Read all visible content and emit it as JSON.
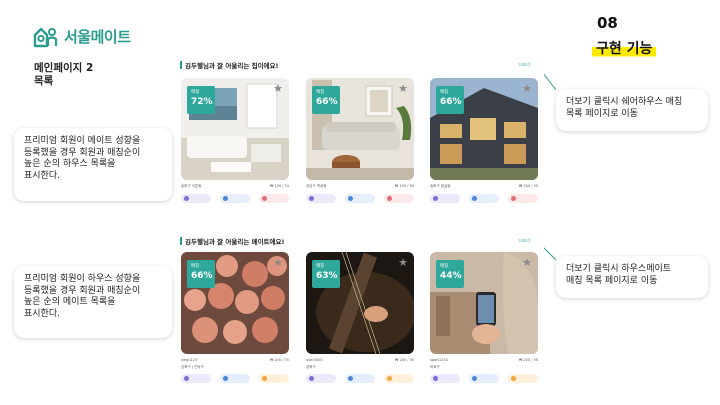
{
  "logo": {
    "text": "서울메이트"
  },
  "page_title": {
    "line1": "메인페이지 2",
    "line2": "목록"
  },
  "section": {
    "number": "08",
    "title": "구현 기능"
  },
  "notes": {
    "left_top": "프리미엄 회원이 메이트 성향을\n등록했을 경우 회원과 매칭순이\n높은 순의 하우스 목록을\n표시한다.",
    "left_bottom": "프리미엄 회원이 하우스 성향을\n등록했을 경우 회원과 매칭순이\n높은 순의 메이트 목록을\n표시한다.",
    "right_top": "더보기 클릭시 쉐어하우스 매칭\n목록 페이지로 이동",
    "right_bottom": "더보기 클릭시 하우스메이트\n매칭 목록 페이지로 이동"
  },
  "houses_panel": {
    "heading": "김두헬님과 잘 어울리는 집이에요!",
    "more": "더보기",
    "cards": [
      {
        "badge_label": "매칭",
        "percent": "72%",
        "name": "송파구 석촌동",
        "price": "₩ 120 / 34"
      },
      {
        "badge_label": "매칭",
        "percent": "66%",
        "name": "강남구 역삼동",
        "price": "₩ 150 / 30"
      },
      {
        "badge_label": "매칭",
        "percent": "66%",
        "name": "송파구 잠실동",
        "price": "₩ 200 / 35"
      }
    ]
  },
  "mates_panel": {
    "heading": "김두헬님과 잘 어울리는 메이트에요!",
    "more": "더보기",
    "cards": [
      {
        "badge_label": "매칭",
        "percent": "66%",
        "name": "yeoju123",
        "price": "₩ 200 / 35",
        "sub": "강북구 | 관악구"
      },
      {
        "badge_label": "매칭",
        "percent": "63%",
        "name": "user0000",
        "price": "₩ 200 / 35",
        "sub": "성북구"
      },
      {
        "badge_label": "매칭",
        "percent": "44%",
        "name": "sport1234",
        "price": "₩ 200 / 30",
        "sub": "마포구"
      }
    ]
  },
  "colors": {
    "accent": "#2a9d8f",
    "highlight": "#ffeb00"
  }
}
